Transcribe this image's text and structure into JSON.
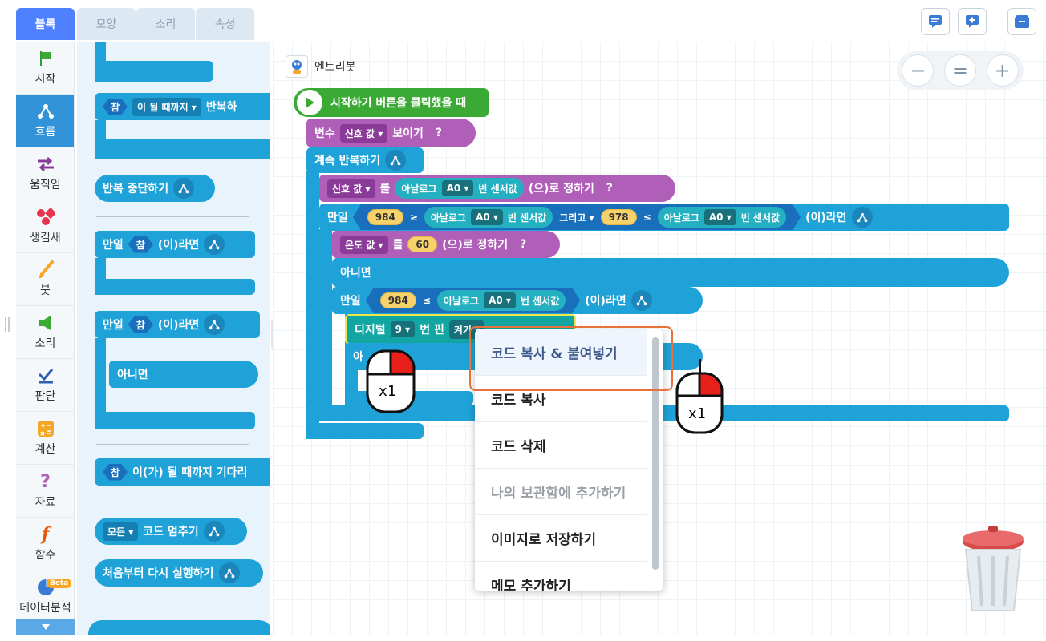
{
  "tabs": [
    "블록",
    "모양",
    "소리",
    "속성"
  ],
  "categories": [
    {
      "label": "시작",
      "icon": "flag-icon"
    },
    {
      "label": "흐름",
      "icon": "flow-icon"
    },
    {
      "label": "움직임",
      "icon": "move-arrows-icon"
    },
    {
      "label": "생김새",
      "icon": "shapes-icon"
    },
    {
      "label": "붓",
      "icon": "brush-icon"
    },
    {
      "label": "소리",
      "icon": "speaker-icon"
    },
    {
      "label": "판단",
      "icon": "check-icon"
    },
    {
      "label": "계산",
      "icon": "calculator-icon"
    },
    {
      "label": "자료",
      "icon": "question-icon"
    },
    {
      "label": "함수",
      "icon": "function-icon"
    },
    {
      "label": "데이터분석",
      "icon": "pie-chart-icon",
      "badge": "Beta"
    }
  ],
  "palette": {
    "repeat_until": {
      "cond": "참",
      "dropdown": "이 될 때까지",
      "text": "반복하"
    },
    "stop_repeat": "반복 중단하기",
    "if1": {
      "label": "만일",
      "cond": "참",
      "suffix": "(이)라면"
    },
    "if2": {
      "label": "만일",
      "cond": "참",
      "suffix": "(이)라면",
      "else": "아니면"
    },
    "wait_until": {
      "cond": "참",
      "text": "이(가) 될 때까지 기다리"
    },
    "stop": {
      "dropdown": "모든",
      "text": "코드 멈추기"
    },
    "restart": "처음부터 다시 실행하기"
  },
  "canvas": {
    "object_name": "엔트리봇",
    "start_block": "시작하기 버튼을 클릭했을 때",
    "show_var": {
      "label": "변수",
      "var": "신호 값",
      "action": "보이기"
    },
    "forever": "계속 반복하기",
    "set1": {
      "var": "신호 값",
      "particle": "를",
      "sensor": "아날로그",
      "port": "A0",
      "sensor_suffix": "번 센서값",
      "action": "(으)로 정하기"
    },
    "if_outer": {
      "label": "만일",
      "left": {
        "num": "984",
        "op": "≥",
        "sensor": "아날로그",
        "port": "A0",
        "sensor_suffix": "번 센서값"
      },
      "joiner": "그리고",
      "right": {
        "num": "978",
        "op": "≤",
        "sensor": "아날로그",
        "port": "A0",
        "sensor_suffix": "번 센서값"
      },
      "suffix": "(이)라면"
    },
    "set2": {
      "var": "온도 값",
      "particle": "를",
      "num": "60",
      "action": "(으)로 정하기"
    },
    "else": "아니면",
    "if_inner": {
      "label": "만일",
      "num": "984",
      "op": "≤",
      "sensor": "아날로그",
      "port": "A0",
      "sensor_suffix": "번 센서값",
      "suffix": "(이)라면"
    },
    "digital": {
      "label": "디지털",
      "pin": "9",
      "text": "번 핀",
      "value": "켜기"
    },
    "else_inner_partial": "아"
  },
  "zoom": {
    "minus": "−",
    "reset": "=",
    "plus": "+"
  },
  "context_menu": [
    {
      "label": "코드 복사 & 붙여넣기",
      "highlighted": true,
      "disabled": false
    },
    {
      "label": "코드 복사",
      "highlighted": false,
      "disabled": false
    },
    {
      "label": "코드 삭제",
      "highlighted": false,
      "disabled": false
    },
    {
      "label": "나의 보관함에 추가하기",
      "highlighted": false,
      "disabled": true
    },
    {
      "label": "이미지로 저장하기",
      "highlighted": false,
      "disabled": false
    },
    {
      "label": "메모 추가하기",
      "highlighted": false,
      "disabled": false
    }
  ],
  "mouse_hints": [
    "x1",
    "x1"
  ],
  "colors": {
    "accent": "#4f80ff",
    "flow": "#1fa2d8",
    "start": "#3aaa35",
    "variable": "#b05fb9",
    "highlight_frame": "#e8703a"
  }
}
